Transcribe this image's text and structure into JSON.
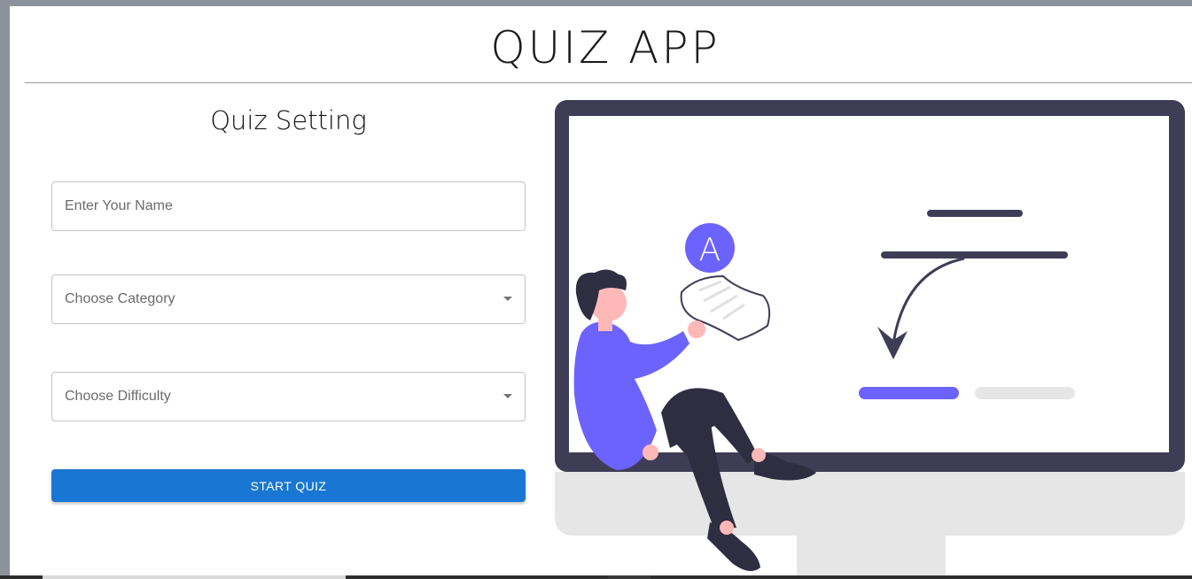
{
  "app": {
    "title": "QUIZ APP"
  },
  "settings": {
    "title": "Quiz Setting",
    "name_placeholder": "Enter Your Name",
    "category_placeholder": "Choose Category",
    "difficulty_placeholder": "Choose Difficulty",
    "start_label": "START QUIZ"
  },
  "illustration": {
    "letter": "A",
    "icons": [
      "monitor-icon",
      "person-reading-icon",
      "arrow-down-icon"
    ]
  },
  "colors": {
    "accent": "#1976d2",
    "illustration_purple": "#6c63ff",
    "monitor_dark": "#3f3d56"
  }
}
